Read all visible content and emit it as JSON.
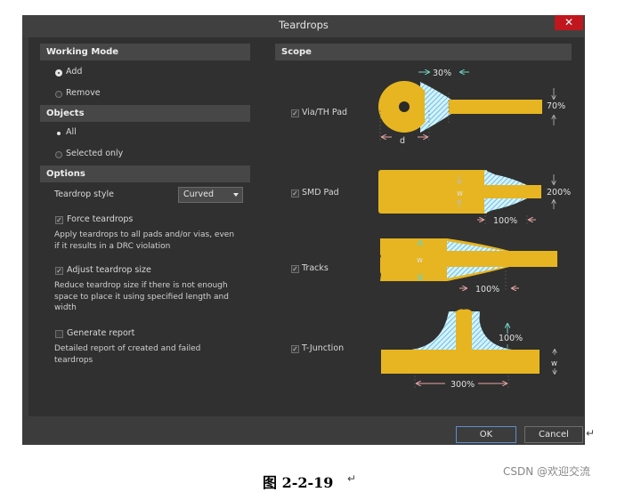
{
  "window": {
    "title": "Teardrops",
    "close_label": "✕"
  },
  "working_mode": {
    "header": "Working Mode",
    "options": [
      {
        "label": "Add",
        "selected": true
      },
      {
        "label": "Remove",
        "selected": false
      }
    ]
  },
  "objects": {
    "header": "Objects",
    "options": [
      {
        "label": "All",
        "selected": true
      },
      {
        "label": "Selected only",
        "selected": false
      }
    ]
  },
  "options": {
    "header": "Options",
    "style_label": "Teardrop style",
    "style_value": "Curved",
    "force": {
      "label": "Force teardrops",
      "checked": true,
      "description": "Apply teardrops to all pads and/or vias, even if it results in a DRC violation"
    },
    "adjust": {
      "label": "Adjust teardrop size",
      "checked": true,
      "description": "Reduce teardrop size if there is not enough space to place it using specified length and width"
    },
    "report": {
      "label": "Generate report",
      "checked": false,
      "description": "Detailed report of created and failed teardrops"
    }
  },
  "scope": {
    "header": "Scope",
    "items": [
      {
        "label": "Via/TH Pad",
        "checked": true,
        "length": "30%",
        "width": "70%",
        "dim": "d"
      },
      {
        "label": "SMD Pad",
        "checked": true,
        "length": "100%",
        "width": "200%",
        "dim": "w"
      },
      {
        "label": "Tracks",
        "checked": true,
        "length": "100%",
        "dim": "w"
      },
      {
        "label": "T-Junction",
        "checked": true,
        "length": "300%",
        "width": "100%",
        "dim": "w"
      }
    ]
  },
  "footer": {
    "ok_label": "OK",
    "cancel_label": "Cancel"
  },
  "caption": "图 2-2-19",
  "watermark": "CSDN @欢迎交流",
  "colors": {
    "pad": "#e6b521",
    "hatch": "#7ed3ee",
    "dim_pink": "#e8a3a3",
    "dim_cyan": "#6fd0c4",
    "dialog_bg": "#303030",
    "close": "#c0171e"
  }
}
